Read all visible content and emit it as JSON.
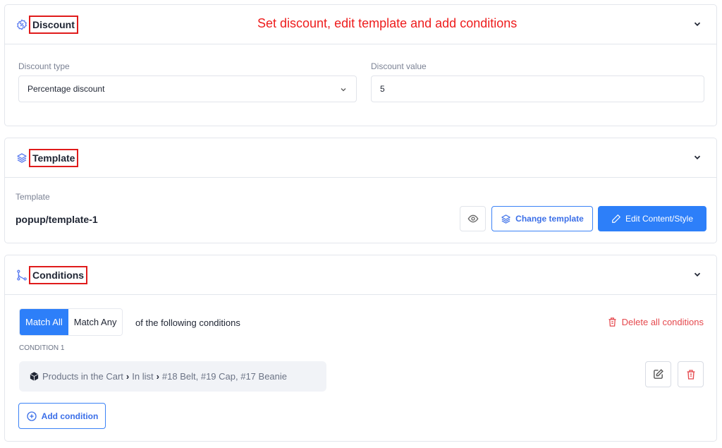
{
  "annotation": "Set discount, edit template and add conditions",
  "colors": {
    "accent": "#2d7ff9",
    "danger": "#e5484d",
    "annotation": "#ee1c1c"
  },
  "discount": {
    "title": "Discount",
    "icon": "discount-badge-icon",
    "type_label": "Discount type",
    "type_value": "Percentage discount",
    "value_label": "Discount value",
    "value": "5"
  },
  "template": {
    "title": "Template",
    "icon": "layers-icon",
    "label": "Template",
    "value": "popup/template-1",
    "preview_icon": "eye-icon",
    "change_label": "Change template",
    "edit_label": "Edit Content/Style"
  },
  "conditions": {
    "title": "Conditions",
    "icon": "branch-icon",
    "match_all": "Match All",
    "match_any": "Match Any",
    "match_selected": "Match All",
    "suffix": "of the following conditions",
    "delete_all": "Delete all conditions",
    "items": [
      {
        "heading": "CONDITION 1",
        "icon": "box-icon",
        "subject": "Products in the Cart",
        "operator": "In list",
        "value": "#18 Belt, #19 Cap, #17 Beanie"
      }
    ],
    "add_label": "Add condition"
  }
}
